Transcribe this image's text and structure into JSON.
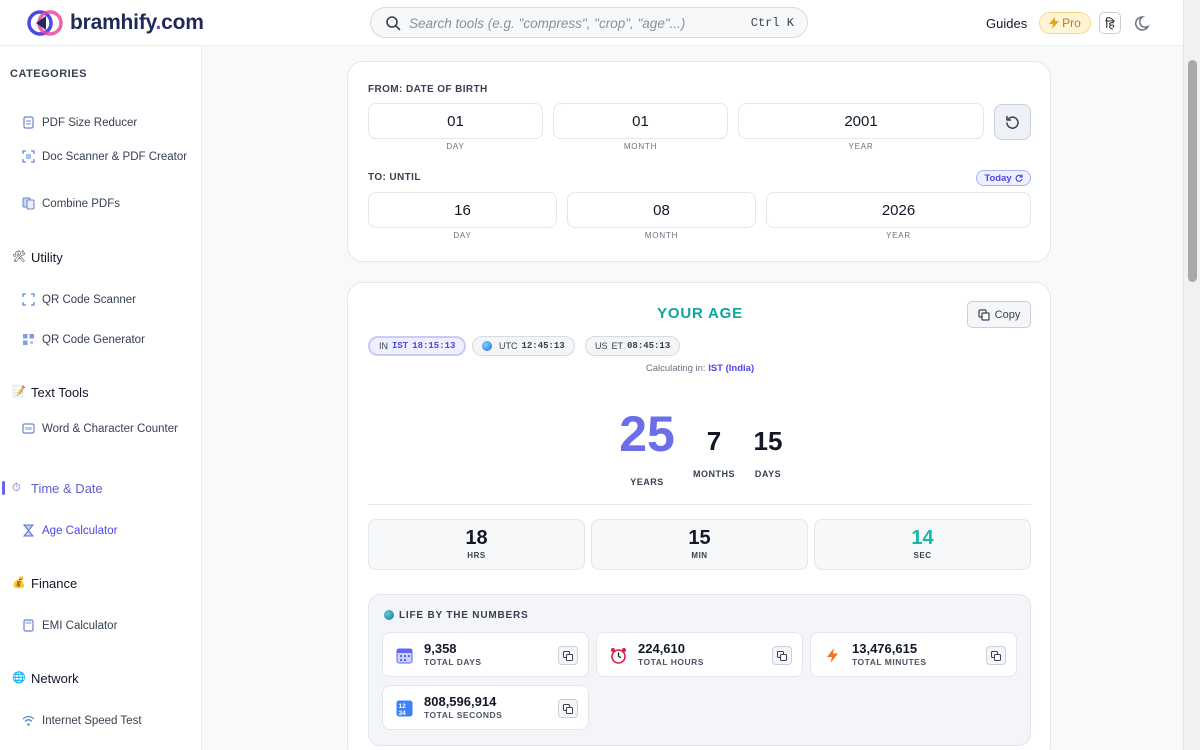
{
  "header": {
    "logo_name": "bramhify",
    "logo_dot": ".",
    "logo_tld": "com",
    "search_placeholder": "Search tools (e.g. \"compress\", \"crop\", \"age\"...)",
    "search_shortcut": "Ctrl K",
    "guides_label": "Guides",
    "pro_label": "Pro",
    "lang_label": "हि"
  },
  "sidebar": {
    "categories_title": "CATEGORIES",
    "top_items": [
      {
        "label": "PDF Size Reducer"
      },
      {
        "label": "Doc Scanner & PDF Creator"
      },
      {
        "label": "Combine PDFs"
      }
    ],
    "groups": {
      "utility": {
        "label": "Utility",
        "items": [
          "QR Code Scanner",
          "QR Code Generator"
        ]
      },
      "text_tools": {
        "label": "Text Tools",
        "items": [
          "Word & Character Counter"
        ]
      },
      "time_date": {
        "label": "Time & Date",
        "items": [
          "Age Calculator"
        ]
      },
      "finance": {
        "label": "Finance",
        "items": [
          "EMI Calculator"
        ]
      },
      "network": {
        "label": "Network",
        "items": [
          "Internet Speed Test"
        ]
      }
    }
  },
  "from": {
    "label": "FROM: DATE OF BIRTH",
    "day": "01",
    "month": "01",
    "year": "2001",
    "day_cap": "DAY",
    "month_cap": "MONTH",
    "year_cap": "YEAR"
  },
  "to": {
    "label": "TO: UNTIL",
    "today_label": "Today",
    "day": "16",
    "month": "08",
    "year": "2026",
    "day_cap": "DAY",
    "month_cap": "MONTH",
    "year_cap": "YEAR"
  },
  "age": {
    "title": "YOUR AGE",
    "copy_label": "Copy",
    "timezones": [
      {
        "flag": "IN",
        "zone": "IST",
        "time": "18:15:13",
        "active": true
      },
      {
        "flag": "",
        "zone": "UTC",
        "time": "12:45:13",
        "active": false
      },
      {
        "flag": "US",
        "zone": "ET",
        "time": "08:45:13",
        "active": false
      }
    ],
    "calculating_prefix": "Calculating in:",
    "calculating_zone": "IST (India)",
    "years": "25",
    "years_cap": "YEARS",
    "months": "7",
    "months_cap": "MONTHS",
    "days": "15",
    "days_cap": "DAYS",
    "hrs": "18",
    "hrs_cap": "HRS",
    "min": "15",
    "min_cap": "MIN",
    "sec": "14",
    "sec_cap": "SEC"
  },
  "numbers": {
    "title": "LIFE BY THE NUMBERS",
    "stats": [
      {
        "value": "9,358",
        "label": "TOTAL DAYS",
        "icon": "calendar-icon"
      },
      {
        "value": "224,610",
        "label": "TOTAL HOURS",
        "icon": "alarm-clock-icon"
      },
      {
        "value": "13,476,615",
        "label": "TOTAL MINUTES",
        "icon": "lightning-icon"
      },
      {
        "value": "808,596,914",
        "label": "TOTAL SECONDS",
        "icon": "numbers-icon"
      }
    ]
  },
  "colors": {
    "accent": "#6366f1",
    "teal": "#0ea5a0",
    "years": "#6b6ee8",
    "pro": "#b7791f"
  }
}
